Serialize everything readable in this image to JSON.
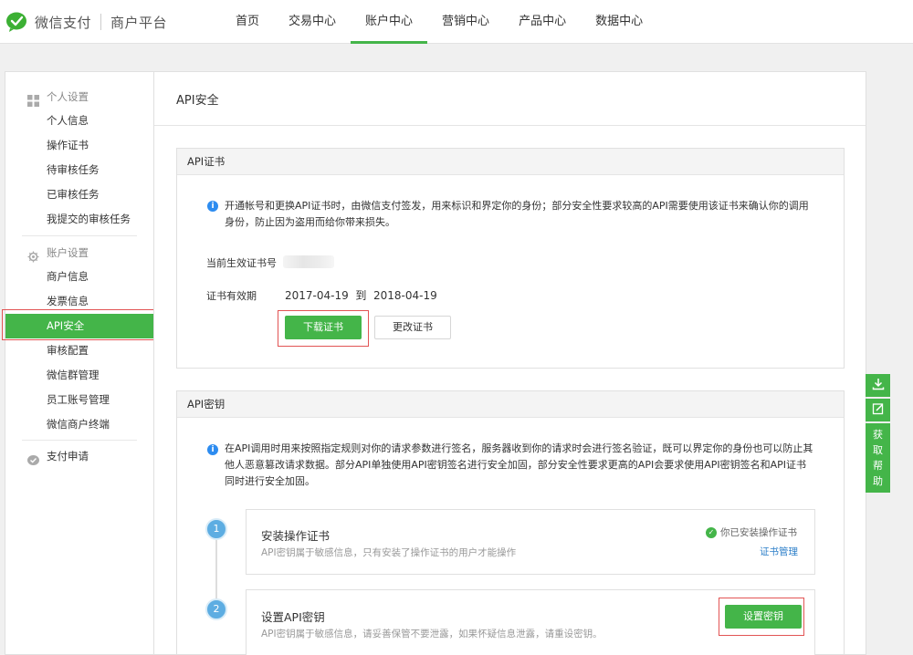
{
  "brand": {
    "name": "微信支付",
    "sub": "商户平台"
  },
  "nav": [
    {
      "label": "首页"
    },
    {
      "label": "交易中心"
    },
    {
      "label": "账户中心",
      "active": true
    },
    {
      "label": "营销中心"
    },
    {
      "label": "产品中心"
    },
    {
      "label": "数据中心"
    }
  ],
  "sidebar": {
    "personal_title": "个人设置",
    "personal_items": [
      "个人信息",
      "操作证书",
      "待审核任务",
      "已审核任务",
      "我提交的审核任务"
    ],
    "account_title": "账户设置",
    "account_items": [
      "商户信息",
      "发票信息",
      "API安全",
      "审核配置",
      "微信群管理",
      "员工账号管理",
      "微信商户终端"
    ],
    "active_item": "API安全",
    "apply_title": "支付申请"
  },
  "main": {
    "title": "API安全",
    "cert": {
      "head": "API证书",
      "info_line1": "开通帐号和更换API证书时，由微信支付签发，用来标识和界定你的身份；部分安全性要求较高的API需要使用该证书来确认你的调用",
      "info_line2": "身份，防止因为盗用而给你带来损失。",
      "serial_label": "当前生效证书号",
      "validity_label": "证书有效期",
      "validity_value": "2017-04-19  到  2018-04-19",
      "download_btn": "下载证书",
      "change_btn": "更改证书"
    },
    "key": {
      "head": "API密钥",
      "info_line1": "在API调用时用来按照指定规则对你的请求参数进行签名，服务器收到你的请求时会进行签名验证，既可以界定你的身份也可以防止其",
      "info_line2": "他人恶意篡改请求数据。部分API单独使用API密钥签名进行安全加固，部分安全性要求更高的API会要求使用API密钥签名和API证书",
      "info_line3": "同时进行安全加固。",
      "step1": {
        "num": "1",
        "title": "安装操作证书",
        "desc": "API密钥属于敏感信息，只有安装了操作证书的用户才能操作",
        "status": "你已安装操作证书",
        "link": "证书管理"
      },
      "step2": {
        "num": "2",
        "title": "设置API密钥",
        "desc": "API密钥属于敏感信息，请妥善保管不要泄露，如果怀疑信息泄露，请重设密钥。",
        "button": "设置密钥"
      }
    }
  },
  "float_tools": {
    "help": [
      "获",
      "取",
      "帮",
      "助"
    ]
  },
  "colors": {
    "accent": "#44b549",
    "highlight": "#e25454",
    "info": "#2d8cf0",
    "link": "#2d7fc9"
  }
}
